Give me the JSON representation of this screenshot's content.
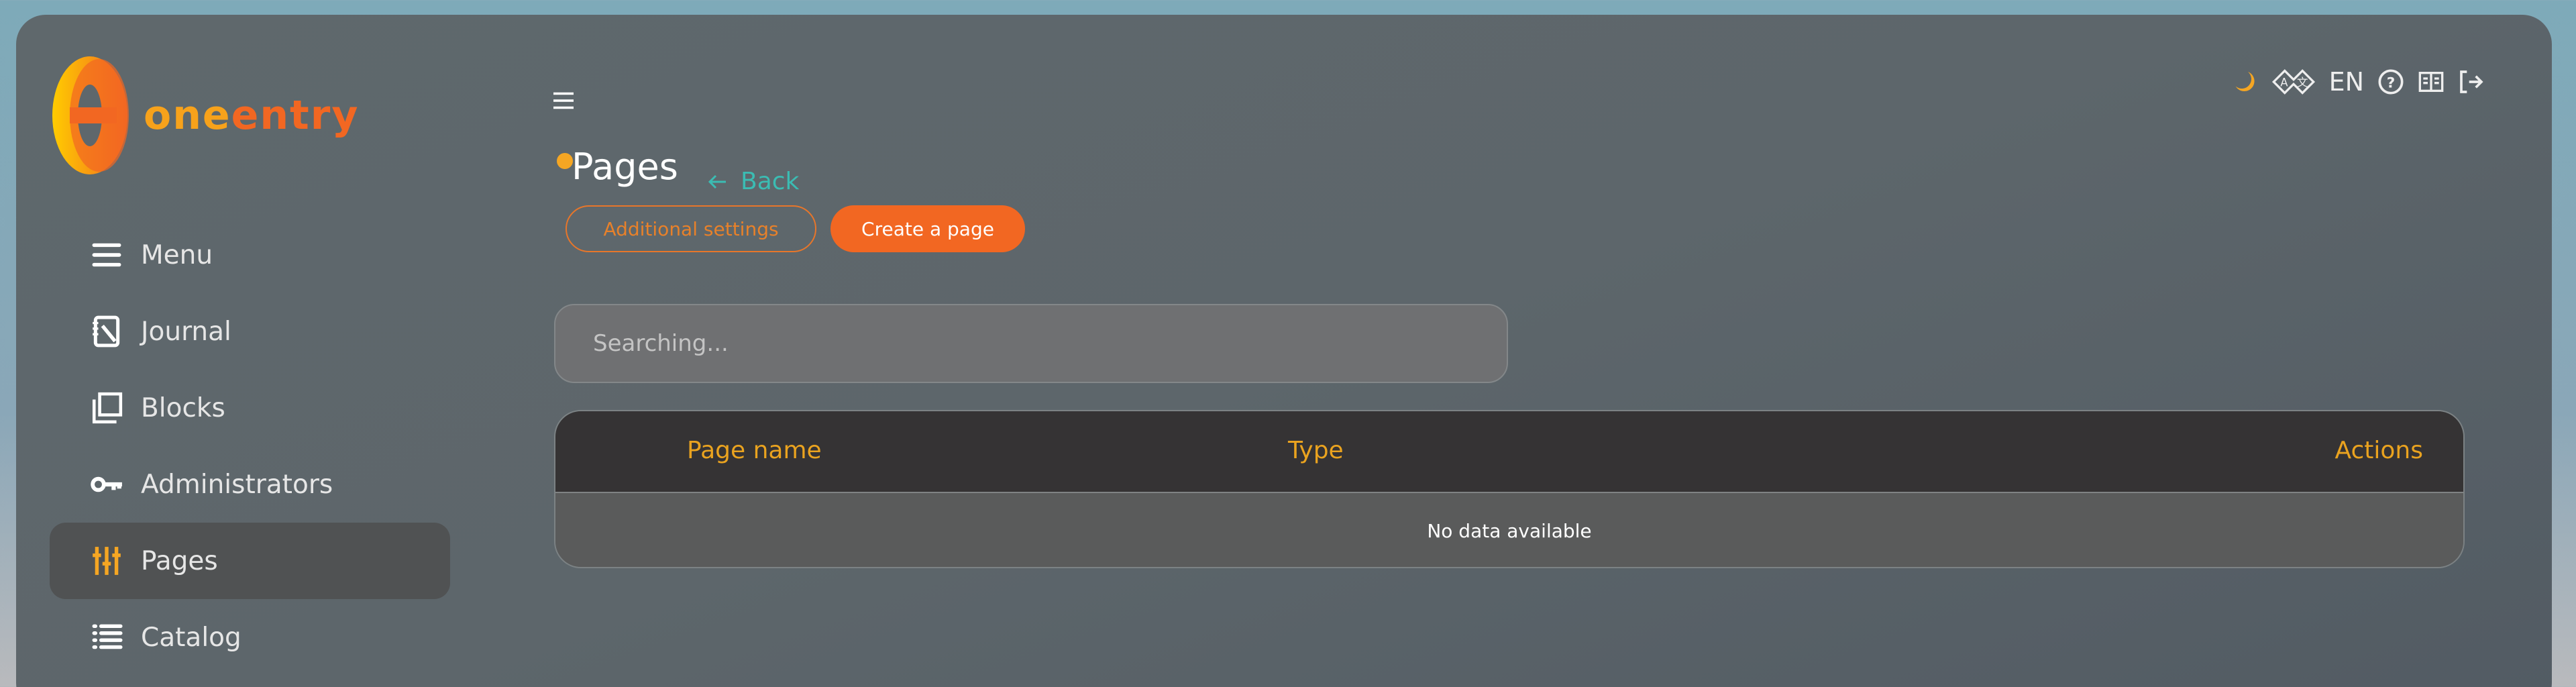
{
  "brand": {
    "name": "oneentry",
    "name_part1": "one",
    "name_part2": "entry",
    "colors": {
      "accent": "#f26722",
      "highlight": "#eaa31f",
      "link": "#3bbcb3"
    }
  },
  "sidebar": {
    "items": [
      {
        "label": "Menu",
        "icon": "menu-icon"
      },
      {
        "label": "Journal",
        "icon": "journal-icon"
      },
      {
        "label": "Blocks",
        "icon": "blocks-icon"
      },
      {
        "label": "Administrators",
        "icon": "key-icon"
      },
      {
        "label": "Pages",
        "icon": "sliders-icon",
        "active": true
      },
      {
        "label": "Catalog",
        "icon": "list-icon"
      }
    ]
  },
  "header": {
    "language": "EN",
    "icons": [
      "moon-icon",
      "translate-icon",
      "help-icon",
      "book-icon",
      "logout-icon"
    ]
  },
  "page": {
    "title": "Pages",
    "back_label": "Back",
    "additional_settings_label": "Additional settings",
    "create_label": "Create a page"
  },
  "search": {
    "placeholder": "Searching...",
    "value": ""
  },
  "table": {
    "columns": [
      "Page name",
      "Type",
      "Actions"
    ],
    "empty_text": "No data available"
  }
}
